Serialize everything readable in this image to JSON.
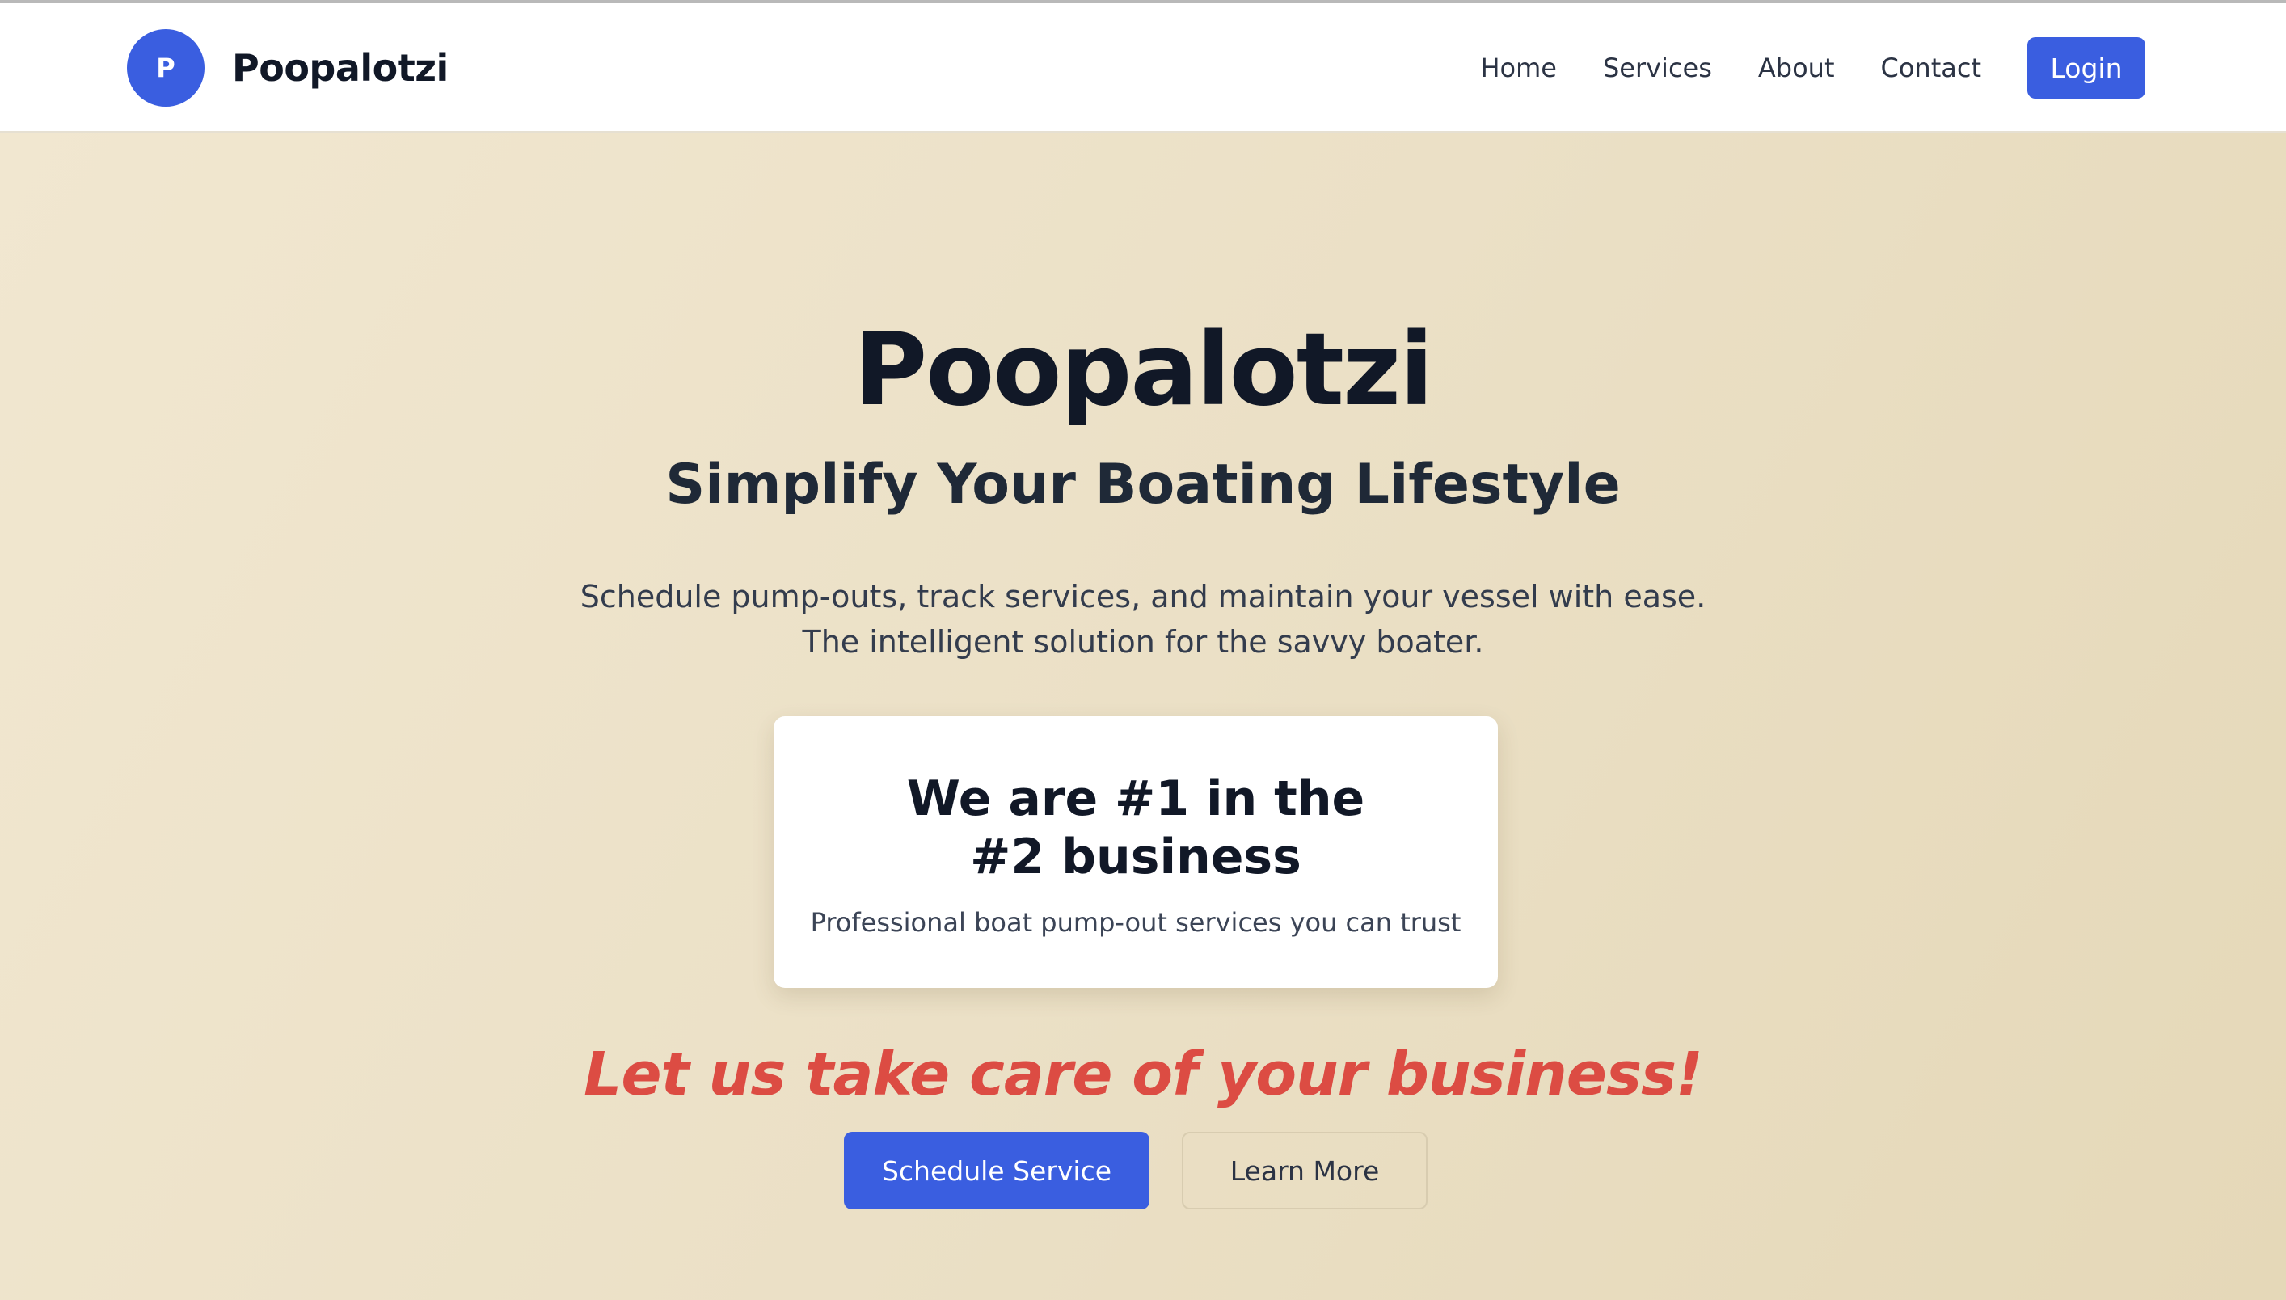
{
  "header": {
    "logo_letter": "P",
    "brand_name": "Poopalotzi",
    "nav": {
      "home": "Home",
      "services": "Services",
      "about": "About",
      "contact": "Contact"
    },
    "login_label": "Login"
  },
  "hero": {
    "title": "Poopalotzi",
    "subtitle": "Simplify Your Boating Lifestyle",
    "description_line1": "Schedule pump-outs, track services, and maintain your vessel with ease.",
    "description_line2": "The intelligent solution for the savvy boater.",
    "card": {
      "title": "We are #1 in the #2 business",
      "subtitle": "Professional boat pump-out services you can trust"
    },
    "tagline": "Let us take care of your business!",
    "primary_button": "Schedule Service",
    "secondary_button": "Learn More"
  },
  "colors": {
    "accent": "#3a5ee0",
    "tagline": "#dc4c43",
    "hero_background": "#ebe0c6"
  }
}
